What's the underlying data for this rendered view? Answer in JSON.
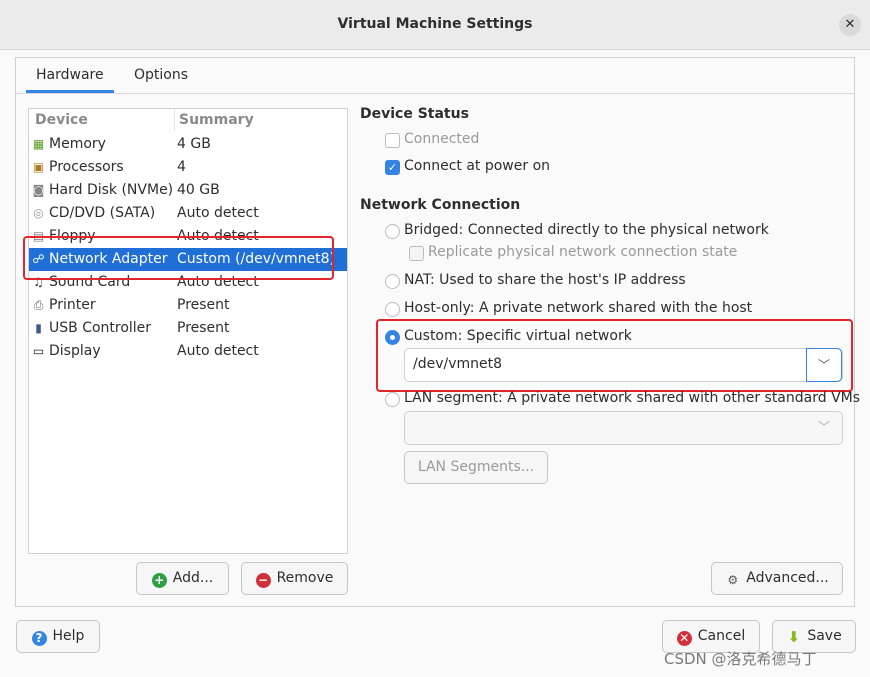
{
  "window": {
    "title": "Virtual Machine Settings",
    "close_icon": "close-icon"
  },
  "tabs": [
    {
      "label": "Hardware",
      "active": true
    },
    {
      "label": "Options",
      "active": false
    }
  ],
  "device_list": {
    "headers": [
      "Device",
      "Summary"
    ],
    "rows": [
      {
        "device": "Memory",
        "summary": "4 GB",
        "icon": "memory-icon"
      },
      {
        "device": "Processors",
        "summary": "4",
        "icon": "processor-icon"
      },
      {
        "device": "Hard Disk (NVMe)",
        "summary": "40 GB",
        "icon": "hard-disk-icon"
      },
      {
        "device": "CD/DVD (SATA)",
        "summary": "Auto detect",
        "icon": "cd-icon"
      },
      {
        "device": "Floppy",
        "summary": "Auto detect",
        "icon": "floppy-icon"
      },
      {
        "device": "Network Adapter",
        "summary": "Custom (/dev/vmnet8)",
        "icon": "network-icon",
        "selected": true
      },
      {
        "device": "Sound Card",
        "summary": "Auto detect",
        "icon": "sound-icon"
      },
      {
        "device": "Printer",
        "summary": "Present",
        "icon": "printer-icon"
      },
      {
        "device": "USB Controller",
        "summary": "Present",
        "icon": "usb-icon"
      },
      {
        "device": "Display",
        "summary": "Auto detect",
        "icon": "display-icon"
      }
    ],
    "add_label": "Add...",
    "remove_label": "Remove"
  },
  "device_status": {
    "title": "Device Status",
    "connected": {
      "label": "Connected",
      "checked": false,
      "disabled": true
    },
    "connect_power_on": {
      "label": "Connect at power on",
      "checked": true
    }
  },
  "network_connection": {
    "title": "Network Connection",
    "bridged": "Bridged: Connected directly to the physical network",
    "replicate": "Replicate physical network connection state",
    "nat": "NAT: Used to share the host's IP address",
    "host_only": "Host-only: A private network shared with the host",
    "custom": "Custom: Specific virtual network",
    "custom_value": "/dev/vmnet8",
    "lan_segment": "LAN segment: A private network shared with other standard VMs",
    "lan_segment_value": "",
    "lan_segments_button": "LAN Segments...",
    "selected": "custom"
  },
  "advanced_label": "Advanced...",
  "footer": {
    "help": "Help",
    "cancel": "Cancel",
    "save": "Save"
  },
  "watermark": "CSDN @洛克希德马丁",
  "colors": {
    "accent": "#3584e4",
    "selection": "#1f6fd6",
    "highlight_box": "#e3262b"
  }
}
